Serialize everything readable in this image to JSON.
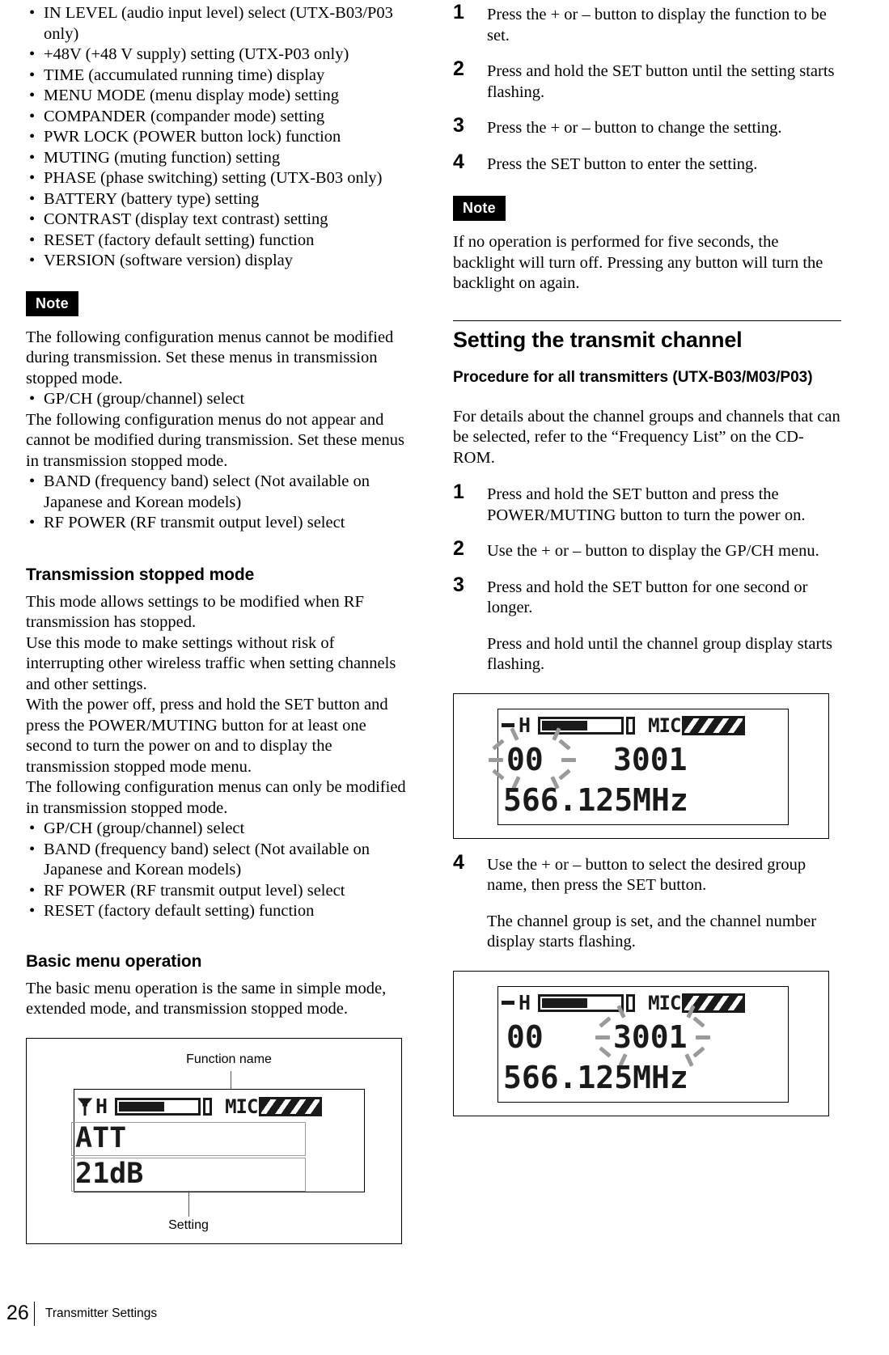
{
  "left_column": {
    "feature_list": [
      "IN LEVEL (audio input level) select (UTX-B03/P03 only)",
      "+48V (+48 V supply) setting (UTX-P03 only)",
      "TIME (accumulated running time) display",
      "MENU MODE (menu display mode) setting",
      "COMPANDER (compander mode) setting",
      "PWR LOCK (POWER button lock) function",
      "MUTING (muting function) setting",
      "PHASE (phase switching) setting (UTX-B03 only)",
      "BATTERY (battery type) setting",
      "CONTRAST (display text contrast) setting",
      "RESET (factory default setting) function",
      "VERSION (software version) display"
    ],
    "note_label": "Note",
    "note_para_1": "The following configuration menus cannot be modified during transmission. Set these menus in transmission stopped mode.",
    "note_bullets_1": [
      "GP/CH (group/channel) select"
    ],
    "note_para_2": "The following configuration menus do not appear and cannot be modified during transmission. Set these menus in transmission stopped mode.",
    "note_bullets_2": [
      "BAND (frequency band) select (Not available on Japanese and Korean models)",
      "RF POWER (RF transmit output level) select"
    ],
    "heading_transmission": "Transmission stopped mode",
    "transmission_para_1": "This mode allows settings to be modified when RF transmission has stopped.",
    "transmission_para_2": "Use this mode to make settings without risk of interrupting other wireless traffic when setting channels and other settings.",
    "transmission_para_3": "With the power off, press and hold the SET button and press the POWER/MUTING button for at least one second to turn the power on and to display the transmission stopped mode menu.",
    "transmission_para_4": "The following configuration menus can only be modified in transmission stopped mode.",
    "transmission_bullets": [
      "GP/CH (group/channel) select",
      "BAND (frequency band) select (Not available on Japanese and Korean models)",
      "RF POWER (RF transmit output level) select",
      "RESET (factory default setting) function"
    ],
    "heading_basic_menu": "Basic menu operation",
    "basic_menu_para": "The basic menu operation is the same in simple mode, extended mode, and transmission stopped mode.",
    "figure_1": {
      "callout_top": "Function name",
      "callout_bottom": "Setting",
      "lcd": {
        "antenna_icon": "antenna-icon",
        "rf_level": "H",
        "mic_label": "MIC",
        "function_name": "ATT",
        "setting_value": "21dB"
      }
    }
  },
  "right_column": {
    "steps_basic": [
      {
        "num": "1",
        "lines": [
          "Press the + or – button to display the function to be set."
        ]
      },
      {
        "num": "2",
        "lines": [
          "Press and hold the SET button until the setting starts flashing."
        ]
      },
      {
        "num": "3",
        "lines": [
          "Press the + or – button to change the setting."
        ]
      },
      {
        "num": "4",
        "lines": [
          "Press the SET button to enter the setting."
        ]
      }
    ],
    "note_label": "Note",
    "note_text": "If no operation is performed for five seconds, the backlight will turn off. Pressing any button will turn the backlight on again.",
    "heading_transmit_channel": "Setting the transmit channel",
    "subheading_procedure": "Procedure for all transmitters (UTX-B03/M03/P03)",
    "intro_para": "For details about the channel groups and channels that can be selected, refer to the “Frequency List” on the CD-ROM.",
    "steps_channel": [
      {
        "num": "1",
        "lines": [
          "Press and hold the SET button and press the POWER/MUTING button to turn the power on."
        ]
      },
      {
        "num": "2",
        "lines": [
          "Use the + or – button to display the GP/CH menu."
        ]
      },
      {
        "num": "3",
        "lines": [
          "Press and hold the SET button for one second or longer.",
          "Press and hold until the channel group display starts flashing."
        ]
      },
      {
        "num": "4",
        "lines": [
          "Use the + or – button to select the desired group name, then press the SET button.",
          "The channel group is set, and the channel number display starts flashing."
        ]
      }
    ],
    "figure_2": {
      "lcd": {
        "dash_mark": "–",
        "rf_level": "H",
        "mic_label": "MIC",
        "group": "00",
        "channel": "3001",
        "frequency": "566.125MHz",
        "flashing_target": "group"
      }
    },
    "figure_3": {
      "lcd": {
        "dash_mark": "–",
        "rf_level": "H",
        "mic_label": "MIC",
        "group": "00",
        "channel": "3001",
        "frequency": "566.125MHz",
        "flashing_target": "channel"
      }
    }
  },
  "footer": {
    "page_number": "26",
    "section_label": "Transmitter Settings"
  }
}
